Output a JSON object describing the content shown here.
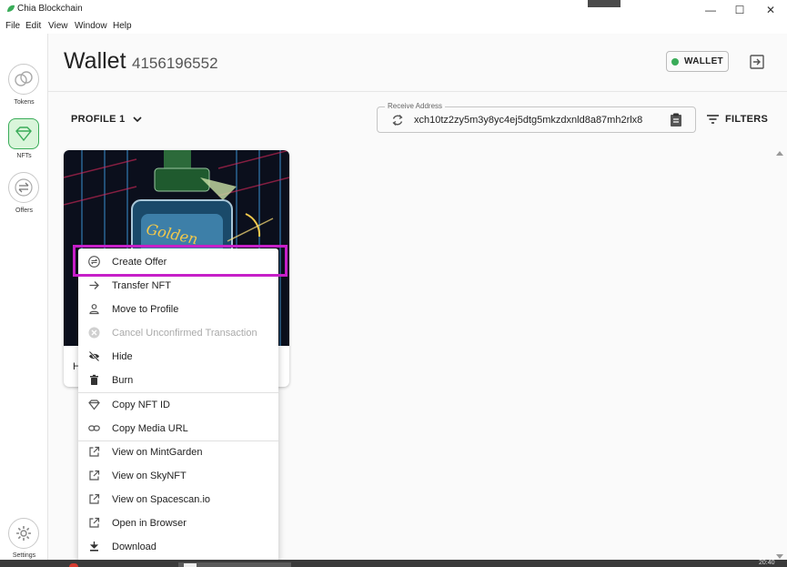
{
  "window": {
    "title": "Chia Blockchain",
    "controls": {
      "minimize": "—",
      "maximize": "☐",
      "close": "✕"
    }
  },
  "menubar": [
    "File",
    "Edit",
    "View",
    "Window",
    "Help"
  ],
  "sidebar": {
    "items": [
      {
        "label": "Tokens",
        "icon": "tokens-icon",
        "active": false
      },
      {
        "label": "NFTs",
        "icon": "nft-diamond-icon",
        "active": true
      },
      {
        "label": "Offers",
        "icon": "offers-swap-icon",
        "active": false
      }
    ],
    "settings": {
      "label": "Settings",
      "icon": "gear-icon"
    }
  },
  "header": {
    "title": "Wallet",
    "wallet_id": "4156196552",
    "badge": {
      "label": "WALLET",
      "status_color": "#3aac59"
    }
  },
  "toolbar": {
    "profile": "PROFILE 1",
    "receive_address": {
      "legend": "Receive Address",
      "value": "xch10tz2zy5m3y8yc4ej5dtg5mkzdxnld8a87mh2rlx8"
    },
    "filters_label": "FILTERS"
  },
  "nft_card": {
    "caption": "H"
  },
  "context_menu": {
    "items": [
      {
        "label": "Create Offer",
        "icon": "offer-swap-icon",
        "disabled": false
      },
      {
        "label": "Transfer NFT",
        "icon": "arrow-right-icon",
        "disabled": false
      },
      {
        "label": "Move to Profile",
        "icon": "person-icon",
        "disabled": false
      },
      {
        "label": "Cancel Unconfirmed Transaction",
        "icon": "cancel-circle-icon",
        "disabled": true
      },
      {
        "label": "Hide",
        "icon": "eye-off-icon",
        "disabled": false
      },
      {
        "label": "Burn",
        "icon": "trash-icon",
        "disabled": false
      },
      {
        "label": "Copy NFT ID",
        "icon": "diamond-icon",
        "disabled": false
      },
      {
        "label": "Copy Media URL",
        "icon": "link-icon",
        "disabled": false
      },
      {
        "label": "View on MintGarden",
        "icon": "external-link-icon",
        "disabled": false
      },
      {
        "label": "View on SkyNFT",
        "icon": "external-link-icon",
        "disabled": false
      },
      {
        "label": "View on Spacescan.io",
        "icon": "external-link-icon",
        "disabled": false
      },
      {
        "label": "Open in Browser",
        "icon": "external-link-icon",
        "disabled": false
      },
      {
        "label": "Download",
        "icon": "download-icon",
        "disabled": false
      }
    ],
    "highlight_color": "#c61fc8"
  },
  "taskbar": {
    "clock": "20:40"
  }
}
